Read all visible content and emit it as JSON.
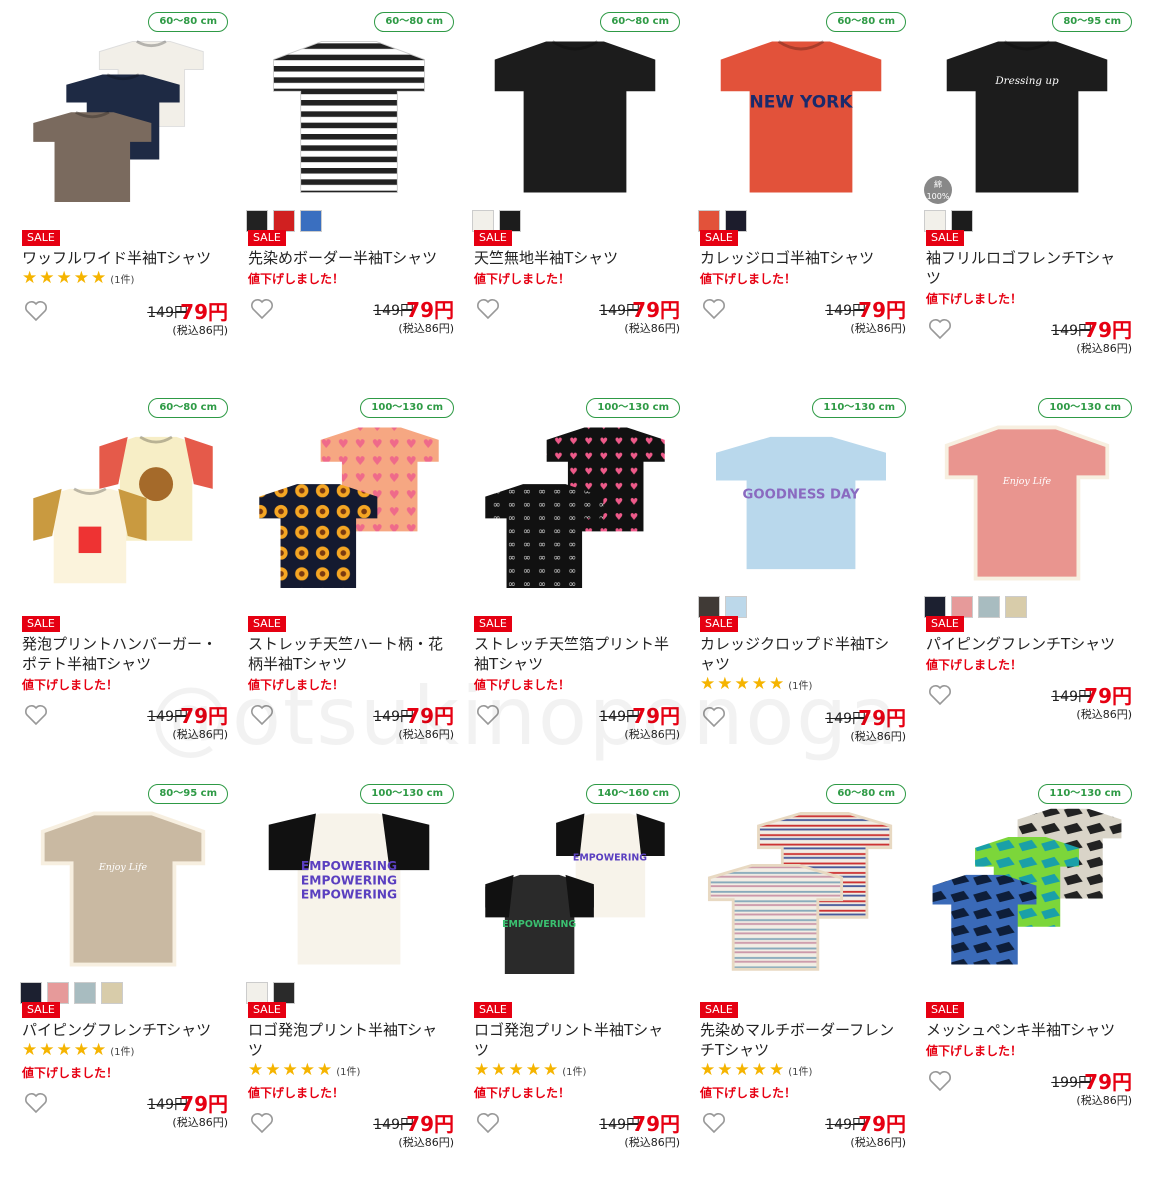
{
  "products": [
    {
      "size": "60〜80 cm",
      "title": "ワッフルワイド半袖Tシャツ",
      "sale": "SALE",
      "stars": true,
      "review": "(1件)",
      "down": "",
      "old": "149円",
      "new": "79円",
      "tax": "(税込86円)",
      "shirt": "stack3",
      "colors": []
    },
    {
      "size": "60〜80 cm",
      "title": "先染めボーダー半袖Tシャツ",
      "sale": "SALE",
      "stars": false,
      "review": "",
      "down": "値下げしました！",
      "old": "149円",
      "new": "79円",
      "tax": "(税込86円)",
      "shirt": "stripe",
      "colors": [
        "#222222",
        "#d02020",
        "#3a6fc0"
      ]
    },
    {
      "size": "60〜80 cm",
      "title": "天竺無地半袖Tシャツ",
      "sale": "SALE",
      "stars": false,
      "review": "",
      "down": "値下げしました！",
      "old": "149円",
      "new": "79円",
      "tax": "(税込86円)",
      "shirt": "black",
      "colors": [
        "#f2f0ea",
        "#1c1c1c"
      ]
    },
    {
      "size": "60〜80 cm",
      "title": "カレッジロゴ半袖Tシャツ",
      "sale": "SALE",
      "stars": false,
      "review": "",
      "down": "値下げしました！",
      "old": "149円",
      "new": "79円",
      "tax": "(税込86円)",
      "shirt": "red-ny",
      "colors": [
        "#e2523a",
        "#1c1c2c"
      ]
    },
    {
      "size": "80〜95 cm",
      "title": "袖フリルロゴフレンチTシャツ",
      "sale": "SALE",
      "stars": false,
      "review": "",
      "down": "値下げしました！",
      "old": "149円",
      "new": "79円",
      "tax": "(税込86円)",
      "shirt": "black-frill",
      "colors": [
        "#f2f0ea",
        "#1c1c1c"
      ]
    },
    {
      "size": "60〜80 cm",
      "title": "発泡プリントハンバーガー・ポテト半袖Tシャツ",
      "sale": "SALE",
      "stars": false,
      "review": "",
      "down": "値下げしました！",
      "old": "149円",
      "new": "79円",
      "tax": "(税込86円)",
      "shirt": "raglan-food",
      "colors": []
    },
    {
      "size": "100〜130 cm",
      "title": "ストレッチ天竺ハート柄・花柄半袖Tシャツ",
      "sale": "SALE",
      "stars": false,
      "review": "",
      "down": "値下げしました！",
      "old": "149円",
      "new": "79円",
      "tax": "(税込86円)",
      "shirt": "heart-flower",
      "colors": []
    },
    {
      "size": "100〜130 cm",
      "title": "ストレッチ天竺箔プリント半袖Tシャツ",
      "sale": "SALE",
      "stars": false,
      "review": "",
      "down": "値下げしました！",
      "old": "149円",
      "new": "79円",
      "tax": "(税込86円)",
      "shirt": "black-pattern",
      "colors": []
    },
    {
      "size": "110〜130 cm",
      "title": "カレッジクロップド半袖Tシャツ",
      "sale": "SALE",
      "stars": true,
      "review": "(1件)",
      "down": "",
      "old": "149円",
      "new": "79円",
      "tax": "(税込86円)",
      "shirt": "lightblue",
      "colors": [
        "#403a36",
        "#bcd8ea"
      ]
    },
    {
      "size": "100〜130 cm",
      "title": "パイピングフレンチTシャツ",
      "sale": "SALE",
      "stars": false,
      "review": "",
      "down": "値下げしました！",
      "old": "149円",
      "new": "79円",
      "tax": "(税込86円)",
      "shirt": "pink",
      "colors": [
        "#1c2030",
        "#e69a9a",
        "#a8bcc0",
        "#d8ccaa"
      ]
    },
    {
      "size": "80〜95 cm",
      "title": "パイピングフレンチTシャツ",
      "sale": "SALE",
      "stars": true,
      "review": "(1件)",
      "down": "値下げしました！",
      "old": "149円",
      "new": "79円",
      "tax": "(税込86円)",
      "shirt": "beige",
      "colors": [
        "#1c2030",
        "#e69a9a",
        "#a8bcc0",
        "#d8ccaa"
      ]
    },
    {
      "size": "100〜130 cm",
      "title": "ロゴ発泡プリント半袖Tシャツ",
      "sale": "SALE",
      "stars": true,
      "review": "(1件)",
      "down": "値下げしました！",
      "old": "149円",
      "new": "79円",
      "tax": "(税込86円)",
      "shirt": "raglan-white",
      "colors": [
        "#f2f0ea",
        "#2a2a2a"
      ]
    },
    {
      "size": "140〜160 cm",
      "title": "ロゴ発泡プリント半袖Tシャツ",
      "sale": "SALE",
      "stars": true,
      "review": "(1件)",
      "down": "値下げしました！",
      "old": "149円",
      "new": "79円",
      "tax": "(税込86円)",
      "shirt": "raglan-duo",
      "colors": []
    },
    {
      "size": "60〜80 cm",
      "title": "先染めマルチボーダーフレンチTシャツ",
      "sale": "SALE",
      "stars": true,
      "review": "(1件)",
      "down": "値下げしました！",
      "old": "149円",
      "new": "79円",
      "tax": "(税込86円)",
      "shirt": "multi-stripe",
      "colors": []
    },
    {
      "size": "110〜130 cm",
      "title": "メッシュペンキ半袖Tシャツ",
      "sale": "SALE",
      "stars": false,
      "review": "",
      "down": "値下げしました！",
      "old": "199円",
      "new": "79円",
      "tax": "(税込86円)",
      "shirt": "camo",
      "colors": []
    }
  ],
  "watermark": "@otsukinoponoga",
  "cotton_label": "綿100%",
  "colors": {
    "sale": "#e60012",
    "badge": "#2e9a45",
    "star": "#f5b400"
  }
}
